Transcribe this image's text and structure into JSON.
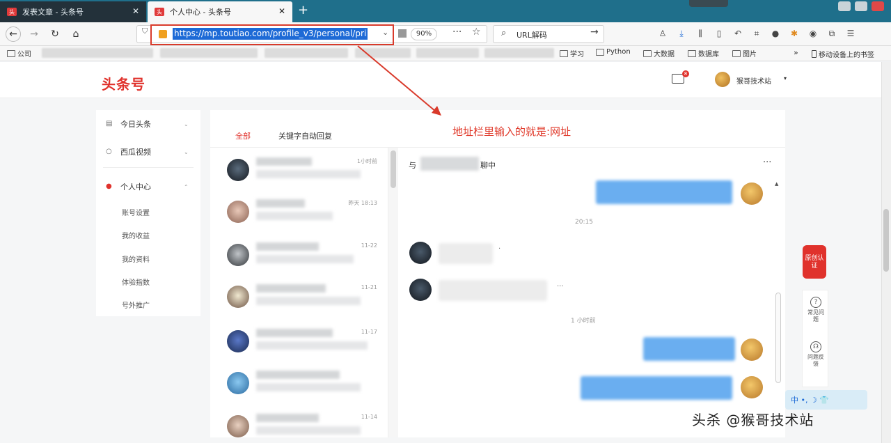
{
  "browser": {
    "tabs": [
      {
        "label": "发表文章 - 头条号",
        "active": false
      },
      {
        "label": "个人中心 - 头条号",
        "active": true
      }
    ],
    "url": "https://mp.toutiao.com/profile_v3/personal/pri",
    "zoom": "90%",
    "search_placeholder": "URL解码",
    "bookmarks": [
      {
        "label": "公司"
      },
      {
        "label": "学习"
      },
      {
        "label": "Python"
      },
      {
        "label": "大数据"
      },
      {
        "label": "数据库"
      },
      {
        "label": "图片"
      }
    ],
    "bookmarks_mobile": "移动设备上的书签"
  },
  "site": {
    "logo": "头条号",
    "user_name": "猴哥技术站",
    "mail_badge": "8"
  },
  "sidebar": {
    "items": [
      {
        "label": "今日头条",
        "icon": "document-icon"
      },
      {
        "label": "西瓜视频",
        "icon": "circle-icon"
      },
      {
        "label": "个人中心",
        "icon": "person-icon",
        "active": true
      }
    ],
    "sub_items": [
      "账号设置",
      "我的收益",
      "我的资料",
      "体验指数",
      "号外推广"
    ]
  },
  "messages": {
    "tabs": [
      "全部",
      "关键字自动回复"
    ],
    "list_times": [
      "1小时前",
      "昨天 18:13",
      "11-22",
      "11-21",
      "11-17",
      "",
      "",
      "11-14"
    ],
    "chat_header_prefix": "与",
    "chat_header_suffix": "聊中",
    "timestamps": [
      "20:15",
      "1 小时前"
    ]
  },
  "annotation": {
    "text": "地址栏里输入的就是:网址",
    "color": "#e03a2b"
  },
  "float": {
    "badge_text": "原创认证",
    "items": [
      "常见问题",
      "问题反馈"
    ]
  },
  "ime": "中 •, ☽ 👕",
  "watermark": "头杀 @猴哥技术站"
}
